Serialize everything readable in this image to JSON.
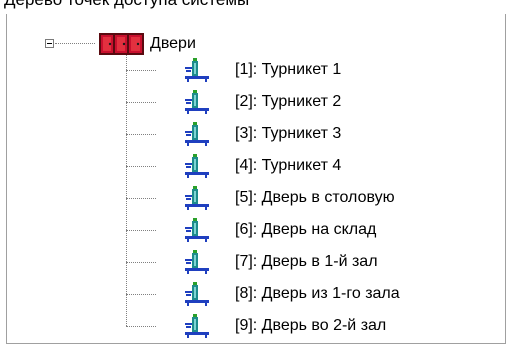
{
  "header": {
    "caption": "Дерево точек доступа системы"
  },
  "tree": {
    "root": {
      "label": "Двери",
      "icon": "doors-group-icon",
      "expanded": true
    },
    "items": [
      {
        "label": "[1]: Турникет 1",
        "icon": "turnstile-icon"
      },
      {
        "label": "[2]: Турникет 2",
        "icon": "turnstile-icon"
      },
      {
        "label": "[3]: Турникет 3",
        "icon": "turnstile-icon"
      },
      {
        "label": "[4]: Турникет 4",
        "icon": "turnstile-icon"
      },
      {
        "label": "[5]: Дверь в столовую",
        "icon": "turnstile-icon"
      },
      {
        "label": "[6]: Дверь на склад",
        "icon": "turnstile-icon"
      },
      {
        "label": "[7]: Дверь в 1-й зал",
        "icon": "turnstile-icon"
      },
      {
        "label": "[8]: Дверь из 1-го зала",
        "icon": "turnstile-icon"
      },
      {
        "label": "[9]: Дверь во 2-й зал",
        "icon": "turnstile-icon"
      }
    ]
  },
  "colors": {
    "root_icon_red": "#c8102e",
    "root_icon_dark": "#5a0a10",
    "turnstile_teal": "#1e8c8c",
    "turnstile_blue": "#1f3fbf",
    "turnstile_green": "#2aa02a",
    "tree_lines": "#808080"
  }
}
